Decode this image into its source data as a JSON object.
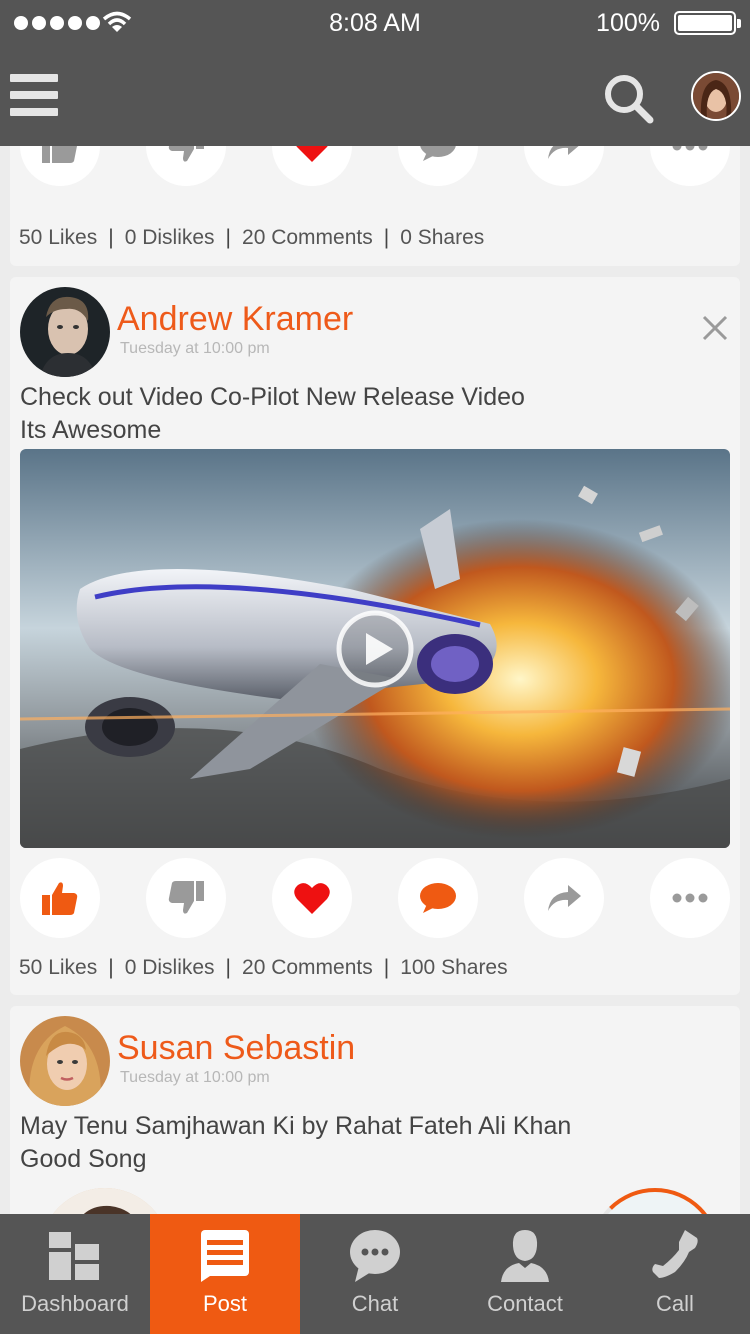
{
  "status_bar": {
    "time": "8:08 AM",
    "battery": "100%"
  },
  "colors": {
    "accent": "#ef5a12",
    "header": "#555555",
    "heart": "#ee1111"
  },
  "posts": [
    {
      "actions": {
        "like": false,
        "dislike": false,
        "heart": true,
        "comment": false
      },
      "stats": {
        "likes": "50 Likes",
        "dislikes": "0 Dislikes",
        "comments": "20 Comments",
        "shares": "0 Shares"
      }
    },
    {
      "author": "Andrew Kramer",
      "time": "Tuesday at 10:00 pm",
      "text_line1": "Check out Video Co-Pilot New Release Video",
      "text_line2": "Its Awesome",
      "media": "video",
      "actions": {
        "like": true,
        "dislike": false,
        "heart": true,
        "comment": true
      },
      "stats": {
        "likes": "50 Likes",
        "dislikes": "0 Dislikes",
        "comments": "20 Comments",
        "shares": "100 Shares"
      }
    },
    {
      "author": "Susan Sebastin",
      "time": "Tuesday at 10:00 pm",
      "text_line1": "May Tenu Samjhawan Ki by Rahat Fateh Ali Khan",
      "text_line2": "Good Song"
    }
  ],
  "tabs": [
    {
      "label": "Dashboard",
      "icon": "dashboard-icon",
      "active": false
    },
    {
      "label": "Post",
      "icon": "post-icon",
      "active": true
    },
    {
      "label": "Chat",
      "icon": "chat-icon",
      "active": false
    },
    {
      "label": "Contact",
      "icon": "contact-icon",
      "active": false
    },
    {
      "label": "Call",
      "icon": "call-icon",
      "active": false
    }
  ]
}
